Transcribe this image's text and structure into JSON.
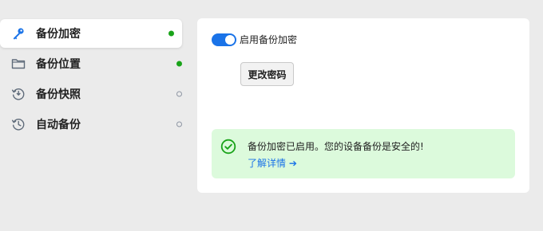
{
  "sidebar": {
    "items": [
      {
        "label": "备份加密",
        "icon": "key-icon",
        "status": "ok",
        "active": true
      },
      {
        "label": "备份位置",
        "icon": "folder-icon",
        "status": "ok",
        "active": false
      },
      {
        "label": "备份快照",
        "icon": "snapshot-clock-icon",
        "status": "off",
        "active": false
      },
      {
        "label": "自动备份",
        "icon": "history-icon",
        "status": "off",
        "active": false
      }
    ]
  },
  "main": {
    "toggle": {
      "label": "启用备份加密",
      "checked": true
    },
    "change_password_button": "更改密码",
    "notice": {
      "icon": "check-circle-icon",
      "text": "备份加密已启用。您的设备备份是安全的!",
      "link": "了解详情 ➔"
    }
  },
  "colors": {
    "accent": "#1a73e8",
    "success": "#19a319",
    "notice_bg": "#dcfadc",
    "background": "#ebebeb"
  }
}
